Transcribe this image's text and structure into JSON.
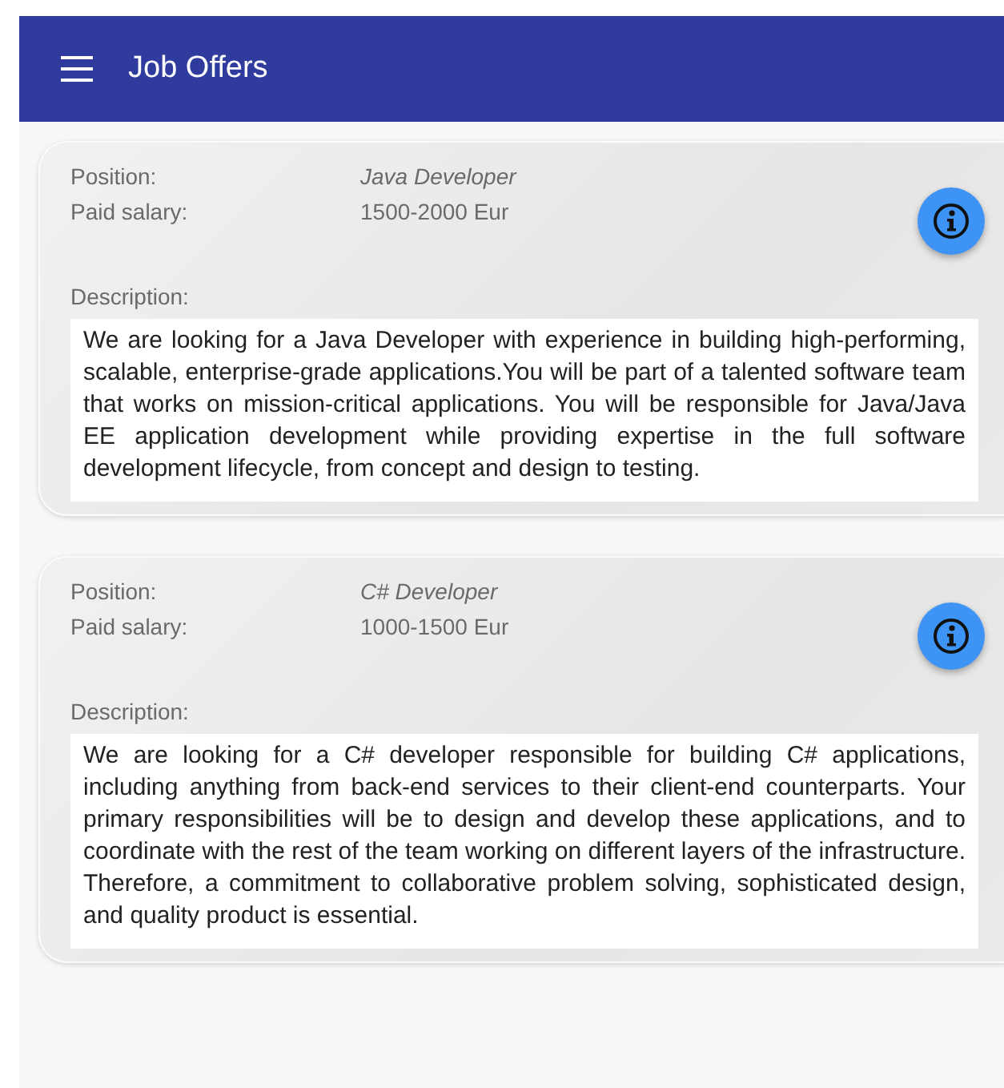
{
  "app_bar": {
    "title": "Job Offers"
  },
  "offers": [
    {
      "position_label": "Position:",
      "position": "Java Developer",
      "salary_label": "Paid salary:",
      "salary": "1500-2000 Eur",
      "description_label": "Description:",
      "description": "We are looking for a Java Developer with experience in building high-performing, scalable, enterprise-grade applications.You will be part of a talented software team that works on mission-critical applications. You will be responsible for Java/Java EE application development while providing expertise in the full software development lifecycle, from concept and design to testing."
    },
    {
      "position_label": "Position:",
      "position": "C# Developer",
      "salary_label": "Paid salary:",
      "salary": "1000-1500 Eur",
      "description_label": "Description:",
      "description": "We are looking for a C# developer responsible for building C# applications, including anything from back-end services to their client-end counterparts. Your primary responsibilities will be to design and develop these applications, and to coordinate with the rest of the team working on different layers of the infrastructure. Therefore, a commitment to collaborative problem solving, sophisticated design, and quality product is essential."
    }
  ]
}
